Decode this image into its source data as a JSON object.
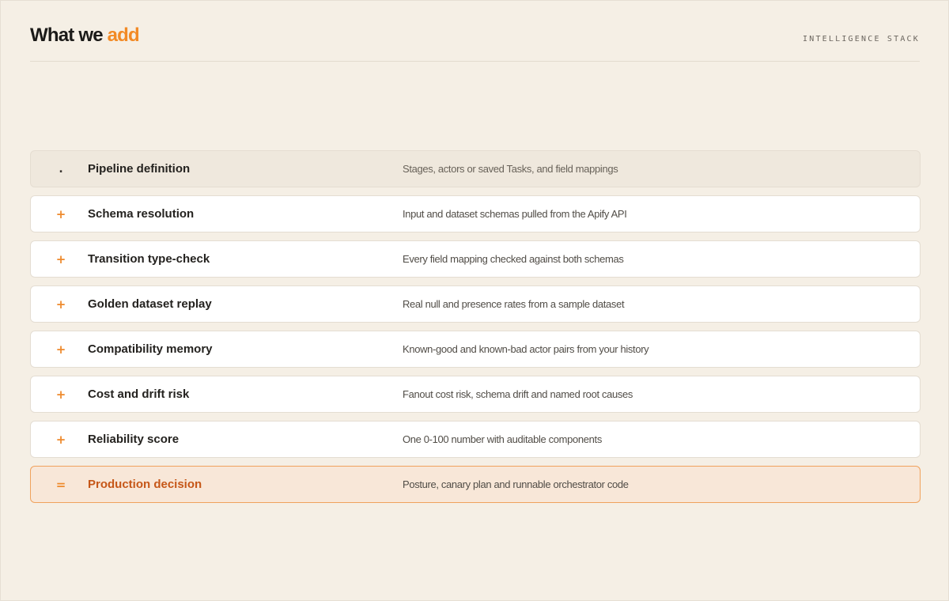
{
  "header": {
    "title_main": "What we ",
    "title_accent": "add",
    "kicker": "INTELLIGENCE STACK"
  },
  "rows": [
    {
      "marker": ".",
      "label": "Pipeline definition",
      "description": "Stages, actors or saved Tasks, and field mappings"
    },
    {
      "marker": "+",
      "label": "Schema resolution",
      "description": "Input and dataset schemas pulled from the Apify API"
    },
    {
      "marker": "+",
      "label": "Transition type-check",
      "description": "Every field mapping checked against both schemas"
    },
    {
      "marker": "+",
      "label": "Golden dataset replay",
      "description": "Real null and presence rates from a sample dataset"
    },
    {
      "marker": "+",
      "label": "Compatibility memory",
      "description": "Known-good and known-bad actor pairs from your history"
    },
    {
      "marker": "+",
      "label": "Cost and drift risk",
      "description": "Fanout cost risk, schema drift and named root causes"
    },
    {
      "marker": "+",
      "label": "Reliability score",
      "description": "One 0-100 number with auditable components"
    },
    {
      "marker": "=",
      "label": "Production decision",
      "description": "Posture, canary plan and runnable orchestrator code"
    }
  ],
  "colors": {
    "accent": "#f28a25",
    "final_text": "#c65718",
    "background": "#f5efe5"
  }
}
